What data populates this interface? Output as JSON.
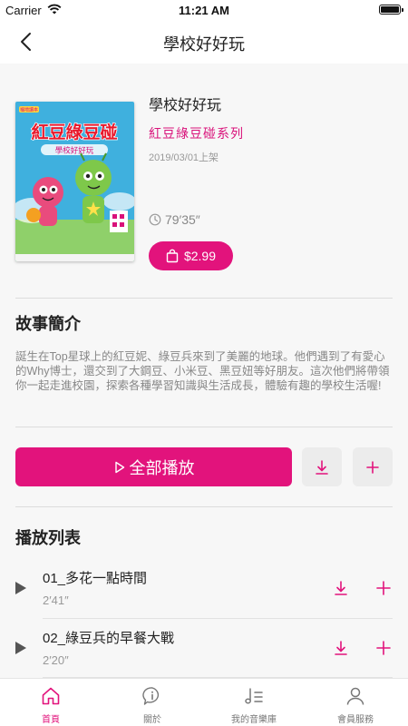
{
  "status_bar": {
    "carrier": "Carrier",
    "time": "11:21 AM"
  },
  "nav": {
    "title": "學校好好玩"
  },
  "book": {
    "title": "學校好好玩",
    "series": "紅豆綠豆碰系列",
    "date": "2019/03/01上架",
    "duration": "79′35″",
    "price": "$2.99",
    "cover": {
      "publisher_badge": "福地讀本",
      "logo_text": "紅豆綠豆碰",
      "subtitle": "學校好好玩"
    }
  },
  "intro": {
    "heading": "故事簡介",
    "text": "誕生在Top星球上的紅豆妮、綠豆兵來到了美麗的地球。他們遇到了有愛心的Why博士，還交到了大鋼豆、小米豆、黑豆妞等好朋友。這次他們將帶領你一起走進校園，探索各種學習知識與生活成長，體驗有趣的學校生活喔!"
  },
  "actions": {
    "play_all_label": "全部播放"
  },
  "playlist": {
    "heading": "播放列表",
    "tracks": [
      {
        "title": "01_多花一點時間",
        "duration": "2′41″"
      },
      {
        "title": "02_綠豆兵的早餐大戰",
        "duration": "2′20″"
      }
    ]
  },
  "tabs": [
    {
      "label": "首頁",
      "icon": "home-icon",
      "active": true
    },
    {
      "label": "關於",
      "icon": "info-bubble-icon",
      "active": false
    },
    {
      "label": "我的音樂庫",
      "icon": "music-library-icon",
      "active": false
    },
    {
      "label": "會員服務",
      "icon": "user-icon",
      "active": false
    }
  ],
  "colors": {
    "accent": "#e2137c",
    "background": "#f7f7f7"
  }
}
